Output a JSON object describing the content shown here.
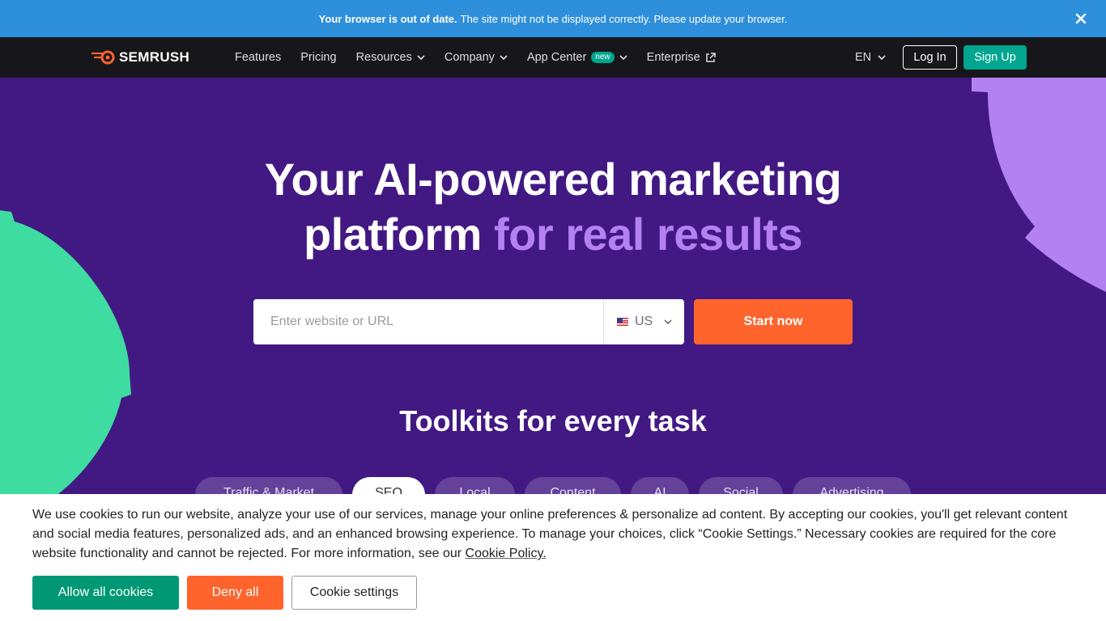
{
  "banner": {
    "bold": "Your browser is out of date.",
    "text": "The site might not be displayed correctly. Please update your browser.",
    "close_icon": "close-icon"
  },
  "nav": {
    "logo": "SEMRUSH",
    "items": [
      {
        "label": "Features"
      },
      {
        "label": "Pricing"
      },
      {
        "label": "Resources"
      },
      {
        "label": "Company"
      },
      {
        "label": "App Center",
        "badge": "new"
      },
      {
        "label": "Enterprise"
      }
    ],
    "language": "EN",
    "login": "Log In",
    "signup": "Sign Up"
  },
  "hero": {
    "title_line1": "Your AI-powered marketing",
    "title_line2_plain": "platform ",
    "title_line2_accent": "for real results",
    "search_placeholder": "Enter website or URL",
    "country": "US",
    "start_button": "Start now"
  },
  "toolkits": {
    "title": "Toolkits for every task",
    "tabs": [
      "Traffic & Market",
      "SEO",
      "Local",
      "Content",
      "AI",
      "Social",
      "Advertising"
    ],
    "active_tab": "SEO"
  },
  "cookie": {
    "text": "We use cookies to run our website, analyze your use of our services, manage your online preferences & personalize ad content. By accepting our cookies, you'll get relevant content and social media features, personalized ads, and an enhanced browsing experience. To manage your choices, click “Cookie Settings.” Necessary cookies are required for the core website functionality and cannot be rejected. For more information, see our ",
    "link": "Cookie Policy.",
    "allow": "Allow all cookies",
    "deny": "Deny all",
    "settings": "Cookie settings"
  },
  "colors": {
    "banner": "#2e8fdb",
    "nav": "#17171b",
    "hero": "#421983",
    "accent_purple": "#b481f3",
    "green_shape": "#3edca0",
    "orange": "#ff642d",
    "teal": "#00a78e"
  }
}
